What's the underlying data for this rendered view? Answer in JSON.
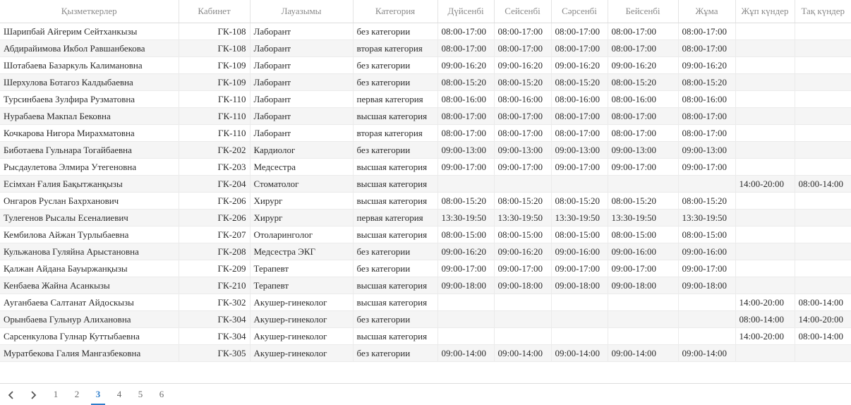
{
  "table": {
    "headers": [
      "Қызметкерлер",
      "Кабинет",
      "Лауазымы",
      "Категория",
      "Дүйсенбі",
      "Сейсенбі",
      "Сәрсенбі",
      "Бейсенбі",
      "Жұма",
      "Жұп күндер",
      "Тақ күндер"
    ],
    "rows": [
      [
        "Шарипбай Айгерим Сейтханкызы",
        "ГК-108",
        "Лаборант",
        "без категории",
        "08:00-17:00",
        "08:00-17:00",
        "08:00-17:00",
        "08:00-17:00",
        "08:00-17:00",
        "",
        ""
      ],
      [
        "Абдирайимова Икбол Равшанбекова",
        "ГК-108",
        "Лаборант",
        "вторая категория",
        "08:00-17:00",
        "08:00-17:00",
        "08:00-17:00",
        "08:00-17:00",
        "08:00-17:00",
        "",
        ""
      ],
      [
        "Шотабаева Базаркуль Калимановна",
        "ГК-109",
        "Лаборант",
        "без категории",
        "09:00-16:20",
        "09:00-16:20",
        "09:00-16:20",
        "09:00-16:20",
        "09:00-16:20",
        "",
        ""
      ],
      [
        "Шерхулова Ботагоз Калдыбаевна",
        "ГК-109",
        "Лаборант",
        "без категории",
        "08:00-15:20",
        "08:00-15:20",
        "08:00-15:20",
        "08:00-15:20",
        "08:00-15:20",
        "",
        ""
      ],
      [
        "Турсинбаева Зулфира Рузматовна",
        "ГК-110",
        "Лаборант",
        "первая категория",
        "08:00-16:00",
        "08:00-16:00",
        "08:00-16:00",
        "08:00-16:00",
        "08:00-16:00",
        "",
        ""
      ],
      [
        "Нурабаева Макпал Бековна",
        "ГК-110",
        "Лаборант",
        "высшая категория",
        "08:00-17:00",
        "08:00-17:00",
        "08:00-17:00",
        "08:00-17:00",
        "08:00-17:00",
        "",
        ""
      ],
      [
        "Кочкарова Нигора Мирахматовна",
        "ГК-110",
        "Лаборант",
        "вторая категория",
        "08:00-17:00",
        "08:00-17:00",
        "08:00-17:00",
        "08:00-17:00",
        "08:00-17:00",
        "",
        ""
      ],
      [
        "Биботаева Гульнара Тогайбаевна",
        "ГК-202",
        "Кардиолог",
        "без категории",
        "09:00-13:00",
        "09:00-13:00",
        "09:00-13:00",
        "09:00-13:00",
        "09:00-13:00",
        "",
        ""
      ],
      [
        "Рысдаулетова Элмира Утегеновна",
        "ГК-203",
        "Медсестра",
        "высшая категория",
        "09:00-17:00",
        "09:00-17:00",
        "09:00-17:00",
        "09:00-17:00",
        "09:00-17:00",
        "",
        ""
      ],
      [
        "Есімхан Ғалия Бақытжанқызы",
        "ГК-204",
        "Стоматолог",
        "высшая категория",
        "",
        "",
        "",
        "",
        "",
        "14:00-20:00",
        "08:00-14:00"
      ],
      [
        "Онгаров Руслан Бахрханович",
        "ГК-206",
        "Хирург",
        "высшая категория",
        "08:00-15:20",
        "08:00-15:20",
        "08:00-15:20",
        "08:00-15:20",
        "08:00-15:20",
        "",
        ""
      ],
      [
        "Тулегенов Рысалы Есеналиевич",
        "ГК-206",
        "Хирург",
        "первая категория",
        "13:30-19:50",
        "13:30-19:50",
        "13:30-19:50",
        "13:30-19:50",
        "13:30-19:50",
        "",
        ""
      ],
      [
        "Кембилова Айжан Турлыбаевна",
        "ГК-207",
        "Отоларинголог",
        "высшая категория",
        "08:00-15:00",
        "08:00-15:00",
        "08:00-15:00",
        "08:00-15:00",
        "08:00-15:00",
        "",
        ""
      ],
      [
        "Кульжанова Гуляйна Арыстановна",
        "ГК-208",
        "Медсестра ЭКГ",
        "без категории",
        "09:00-16:20",
        "09:00-16:20",
        "09:00-16:00",
        "09:00-16:00",
        "09:00-16:00",
        "",
        ""
      ],
      [
        "Қалжан Айдана Бауыржанқызы",
        "ГК-209",
        "Терапевт",
        "без категории",
        "09:00-17:00",
        "09:00-17:00",
        "09:00-17:00",
        "09:00-17:00",
        "09:00-17:00",
        "",
        ""
      ],
      [
        "Кенбаева Жайна Асанкызы",
        "ГК-210",
        "Терапевт",
        "высшая категория",
        "09:00-18:00",
        "09:00-18:00",
        "09:00-18:00",
        "09:00-18:00",
        "09:00-18:00",
        "",
        ""
      ],
      [
        "Ауганбаева Салтанат Айдоскызы",
        "ГК-302",
        "Акушер-гинеколог",
        "высшая категория",
        "",
        "",
        "",
        "",
        "",
        "14:00-20:00",
        "08:00-14:00"
      ],
      [
        "Орынбаева Гульнур Алихановна",
        "ГК-304",
        "Акушер-гинеколог",
        "без категории",
        "",
        "",
        "",
        "",
        "",
        "08:00-14:00",
        "14:00-20:00"
      ],
      [
        "Сарсенкулова Гулнар Куттыбаевна",
        "ГК-304",
        "Акушер-гинеколог",
        "высшая категория",
        "",
        "",
        "",
        "",
        "",
        "14:00-20:00",
        "08:00-14:00"
      ],
      [
        "Муратбекова Галия Мангазбековна",
        "ГК-305",
        "Акушер-гинеколог",
        "без категории",
        "09:00-14:00",
        "09:00-14:00",
        "09:00-14:00",
        "09:00-14:00",
        "09:00-14:00",
        "",
        ""
      ]
    ]
  },
  "pagination": {
    "prev_icon": "chevron-left-icon",
    "next_icon": "chevron-right-icon",
    "pages": [
      "1",
      "2",
      "3",
      "4",
      "5",
      "6"
    ],
    "current": "3",
    "active_color": "#2f7ecb"
  }
}
